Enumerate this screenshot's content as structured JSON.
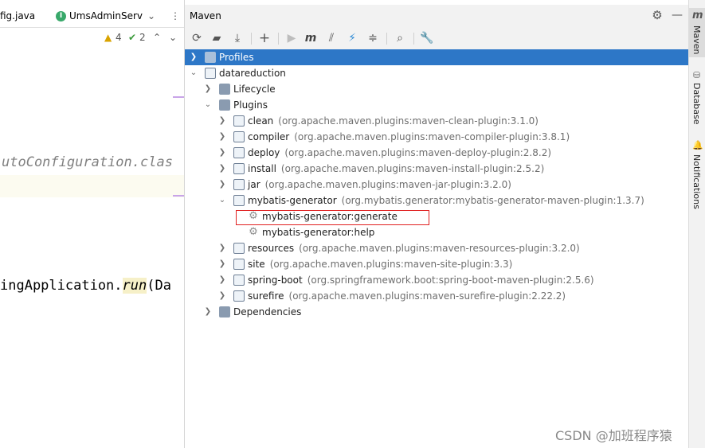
{
  "editor": {
    "tabs": [
      {
        "label": "fig.java"
      },
      {
        "label": "UmsAdminServ",
        "icon_letter": "I"
      }
    ],
    "tab_dropdown": "⌄",
    "tab_more": "⋮",
    "status": {
      "warnings": "4",
      "checks": "2"
    },
    "code_lines": [
      {
        "text": "utoConfiguration.clas"
      },
      {
        "text_before": "ingApplication.",
        "method": "run",
        "text_after": "(Da"
      }
    ]
  },
  "maven": {
    "title": "Maven",
    "header_icons": [
      "gear-icon",
      "minimize-icon"
    ],
    "toolbar_icons": [
      "reload-icon",
      "add-folder-icon",
      "download-icon",
      "plus-icon",
      "run-icon",
      "maven-m-icon",
      "toggle-offline-icon",
      "lightning-icon",
      "collapse-icon",
      "analyze-icon",
      "wrench-icon"
    ],
    "tree": {
      "profiles": "Profiles",
      "project": "datareduction",
      "lifecycle": "Lifecycle",
      "plugins": "Plugins",
      "plugin_items": [
        {
          "name": "clean",
          "coord": "(org.apache.maven.plugins:maven-clean-plugin:3.1.0)"
        },
        {
          "name": "compiler",
          "coord": "(org.apache.maven.plugins:maven-compiler-plugin:3.8.1)"
        },
        {
          "name": "deploy",
          "coord": "(org.apache.maven.plugins:maven-deploy-plugin:2.8.2)"
        },
        {
          "name": "install",
          "coord": "(org.apache.maven.plugins:maven-install-plugin:2.5.2)"
        },
        {
          "name": "jar",
          "coord": "(org.apache.maven.plugins:maven-jar-plugin:3.2.0)"
        },
        {
          "name": "mybatis-generator",
          "coord": "(org.mybatis.generator:mybatis-generator-maven-plugin:1.3.7)"
        },
        {
          "name": "resources",
          "coord": "(org.apache.maven.plugins:maven-resources-plugin:3.2.0)"
        },
        {
          "name": "site",
          "coord": "(org.apache.maven.plugins:maven-site-plugin:3.3)"
        },
        {
          "name": "spring-boot",
          "coord": "(org.springframework.boot:spring-boot-maven-plugin:2.5.6)"
        },
        {
          "name": "surefire",
          "coord": "(org.apache.maven.plugins:maven-surefire-plugin:2.22.2)"
        }
      ],
      "goals": [
        "mybatis-generator:generate",
        "mybatis-generator:help"
      ],
      "dependencies": "Dependencies"
    }
  },
  "side_strip": {
    "maven_label": "Maven",
    "maven_icon_letter": "m",
    "database_label": "Database",
    "notifications_label": "Notifications"
  },
  "watermark": "CSDN @加班程序猿",
  "colors": {
    "selection": "#2d77c7",
    "highlight_border": "#e02020",
    "panel_bg": "#f2f2f2"
  }
}
